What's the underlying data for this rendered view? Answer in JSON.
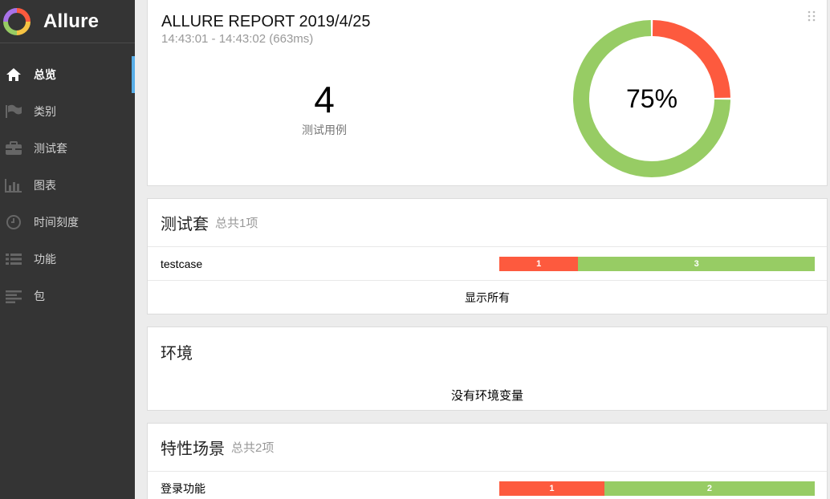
{
  "brand": {
    "name": "Allure"
  },
  "nav": [
    {
      "label": "总览",
      "icon": "home-icon",
      "active": true
    },
    {
      "label": "类别",
      "icon": "flag-icon"
    },
    {
      "label": "测试套",
      "icon": "briefcase-icon"
    },
    {
      "label": "图表",
      "icon": "bar-chart-icon"
    },
    {
      "label": "时间刻度",
      "icon": "clock-icon"
    },
    {
      "label": "功能",
      "icon": "list-icon"
    },
    {
      "label": "包",
      "icon": "align-left-icon"
    }
  ],
  "summary": {
    "title": "ALLURE REPORT 2019/4/25",
    "time": "14:43:01 - 14:43:02 (663ms)",
    "count": "4",
    "count_label": "测试用例",
    "percent_label": "75%",
    "chart": {
      "passed_fraction": 0.75,
      "failed_fraction": 0.25
    }
  },
  "suites": {
    "title": "测试套",
    "count": "总共1项",
    "rows": [
      {
        "name": "testcase",
        "failed": 1,
        "passed": 3
      }
    ],
    "show_all": "显示所有"
  },
  "environment": {
    "title": "环境",
    "empty": "没有环境变量"
  },
  "features": {
    "title": "特性场景",
    "count": "总共2项",
    "rows": [
      {
        "name": "登录功能",
        "failed": 1,
        "passed": 2
      }
    ]
  },
  "colors": {
    "failed": "#fd5a3e",
    "passed": "#97cc64",
    "sidebar": "#343434",
    "accent": "#58aee8"
  }
}
